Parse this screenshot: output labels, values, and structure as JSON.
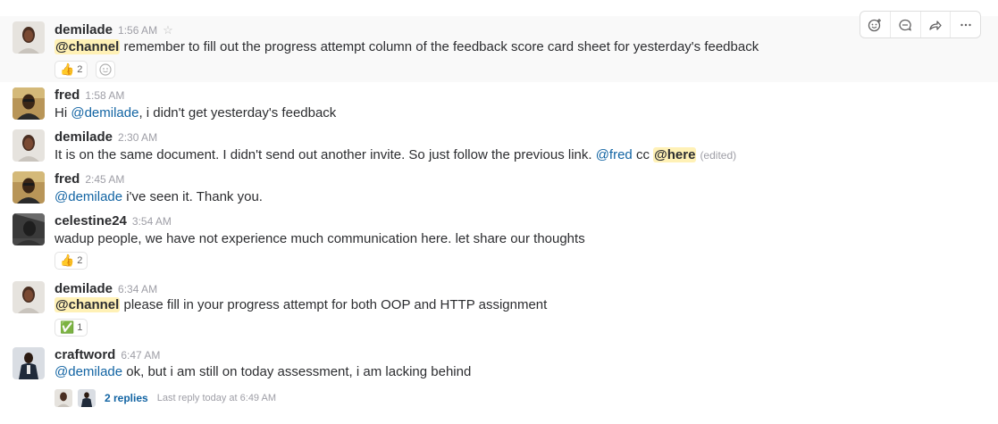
{
  "messages": [
    {
      "user": "demilade",
      "time": "1:56 AM",
      "parts": [
        {
          "t": "broadcast",
          "v": "@channel"
        },
        {
          "t": "text",
          "v": " remember to fill out the progress attempt column of the feedback score card sheet for yesterday's feedback"
        }
      ],
      "reactions": [
        {
          "emoji": "👍",
          "count": "2"
        }
      ]
    },
    {
      "user": "fred",
      "time": "1:58 AM",
      "parts": [
        {
          "t": "text",
          "v": "Hi "
        },
        {
          "t": "mention",
          "v": "@demilade"
        },
        {
          "t": "text",
          "v": ", i didn't get yesterday's feedback"
        }
      ]
    },
    {
      "user": "demilade",
      "time": "2:30 AM",
      "parts": [
        {
          "t": "text",
          "v": "It is on the same document. I didn't send out another invite. So just follow the previous link. "
        },
        {
          "t": "mention",
          "v": "@fred"
        },
        {
          "t": "text",
          "v": " cc "
        },
        {
          "t": "broadcast",
          "v": "@here"
        }
      ],
      "edited": "(edited)"
    },
    {
      "user": "fred",
      "time": "2:45 AM",
      "parts": [
        {
          "t": "mention",
          "v": "@demilade"
        },
        {
          "t": "text",
          "v": " i've seen it. Thank you."
        }
      ]
    },
    {
      "user": "celestine24",
      "time": "3:54 AM",
      "parts": [
        {
          "t": "text",
          "v": "wadup people, we have not experience much communication here. let share our thoughts"
        }
      ],
      "reactions": [
        {
          "emoji": "👍",
          "count": "2"
        }
      ]
    },
    {
      "user": "demilade",
      "time": "6:34 AM",
      "parts": [
        {
          "t": "broadcast",
          "v": "@channel"
        },
        {
          "t": "text",
          "v": " please fill in your progress attempt for both OOP and HTTP  assignment"
        }
      ],
      "reactions": [
        {
          "emoji": "✅",
          "count": "1"
        }
      ]
    },
    {
      "user": "craftword",
      "time": "6:47 AM",
      "parts": [
        {
          "t": "mention",
          "v": "@demilade"
        },
        {
          "t": "text",
          "v": " ok, but i am still on today assessment, i am lacking behind"
        }
      ],
      "thread": {
        "replies": "2 replies",
        "last_reply": "Last reply today at 6:49 AM"
      }
    }
  ],
  "toolbar": {
    "items": [
      {
        "name": "add-reaction-icon",
        "glyph": "☺"
      },
      {
        "name": "reply-thread-icon",
        "glyph": "💬"
      },
      {
        "name": "share-icon",
        "glyph": "➦"
      },
      {
        "name": "more-actions-icon",
        "glyph": "⋯"
      }
    ]
  },
  "colors": {
    "mention": "#1264a3",
    "broadcast_bg": "#fff1b6",
    "hover_bg": "#f9f9f9"
  }
}
